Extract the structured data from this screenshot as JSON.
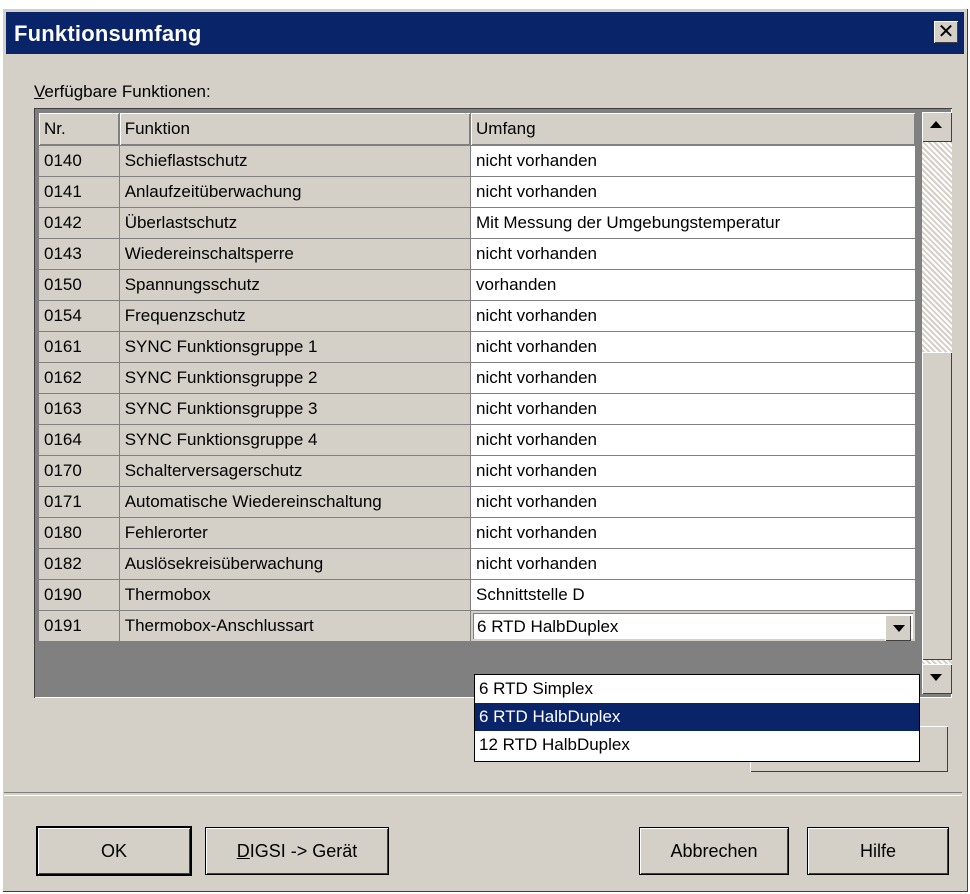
{
  "window": {
    "title": "Funktionsumfang",
    "close_glyph": "✕"
  },
  "label": {
    "available_prefix": "V",
    "available_rest": "erfügbare Funktionen:"
  },
  "table": {
    "headers": {
      "nr": "Nr.",
      "funktion": "Funktion",
      "umfang": "Umfang"
    },
    "rows": [
      {
        "nr": "0140",
        "funktion": "Schieflastschutz",
        "umfang": "nicht vorhanden"
      },
      {
        "nr": "0141",
        "funktion": "Anlaufzeitüberwachung",
        "umfang": "nicht vorhanden"
      },
      {
        "nr": "0142",
        "funktion": "Überlastschutz",
        "umfang": "Mit Messung der Umgebungstemperatur"
      },
      {
        "nr": "0143",
        "funktion": "Wiedereinschaltsperre",
        "umfang": "nicht vorhanden"
      },
      {
        "nr": "0150",
        "funktion": "Spannungsschutz",
        "umfang": "vorhanden"
      },
      {
        "nr": "0154",
        "funktion": "Frequenzschutz",
        "umfang": "nicht vorhanden"
      },
      {
        "nr": "0161",
        "funktion": "SYNC Funktionsgruppe 1",
        "umfang": "nicht vorhanden"
      },
      {
        "nr": "0162",
        "funktion": "SYNC Funktionsgruppe 2",
        "umfang": "nicht vorhanden"
      },
      {
        "nr": "0163",
        "funktion": "SYNC Funktionsgruppe 3",
        "umfang": "nicht vorhanden"
      },
      {
        "nr": "0164",
        "funktion": "SYNC Funktionsgruppe 4",
        "umfang": "nicht vorhanden"
      },
      {
        "nr": "0170",
        "funktion": "Schalterversagerschutz",
        "umfang": "nicht vorhanden"
      },
      {
        "nr": "0171",
        "funktion": "Automatische Wiedereinschaltung",
        "umfang": "nicht vorhanden"
      },
      {
        "nr": "0180",
        "funktion": "Fehlerorter",
        "umfang": "nicht vorhanden"
      },
      {
        "nr": "0182",
        "funktion": "Auslösekreisüberwachung",
        "umfang": "nicht vorhanden"
      },
      {
        "nr": "0190",
        "funktion": "Thermobox",
        "umfang": "Schnittstelle D"
      }
    ],
    "dropdown_row": {
      "nr": "0191",
      "funktion": "Thermobox-Anschlussart",
      "umfang": "6 RTD HalbDuplex"
    }
  },
  "dropdown_options": [
    "6 RTD Simplex",
    "6 RTD HalbDuplex",
    "12 RTD HalbDuplex"
  ],
  "dropdown_selected_index": 1,
  "buttons": {
    "ok": "OK",
    "digsi_prefix": "D",
    "digsi_rest": "IGSI -> Gerät",
    "abbrechen": "Abbrechen",
    "hilfe": "Hilfe"
  },
  "colors": {
    "titlebar": "#0a246a",
    "face": "#d4d0c8",
    "selection": "#0a246a"
  }
}
